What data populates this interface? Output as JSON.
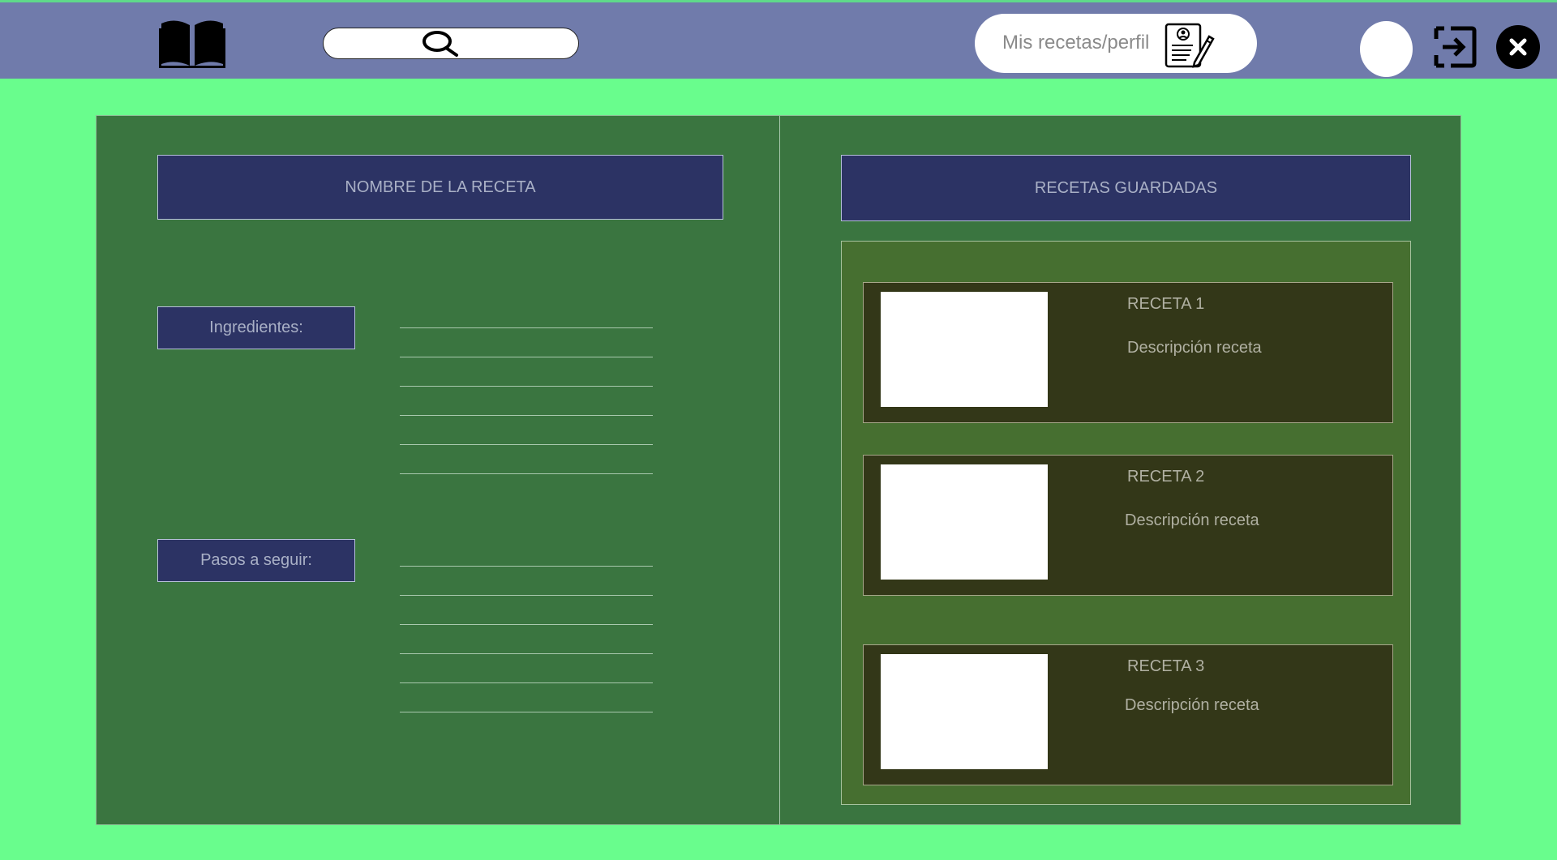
{
  "header": {
    "profile_label": "Mis recetas/perfil",
    "icons": [
      "book-icon",
      "search-icon",
      "profile-edit-icon",
      "avatar",
      "logout-icon",
      "close-icon"
    ]
  },
  "recipe": {
    "title": "NOMBRE DE LA RECETA",
    "ingredients_label": "Ingredientes:",
    "steps_label": "Pasos a seguir:"
  },
  "saved": {
    "title": "RECETAS GUARDADAS",
    "items": [
      {
        "name": "RECETA 1",
        "description": "Descripción receta"
      },
      {
        "name": "RECETA 2",
        "description": "Descripción receta"
      },
      {
        "name": "RECETA 3",
        "description": "Descripción receta"
      }
    ]
  },
  "colors": {
    "background": "#69fd8d",
    "header": "#707bab",
    "book": "#3a7540",
    "title_box": "#2c3364",
    "saved_panel": "#466f30",
    "card": "#333718"
  }
}
